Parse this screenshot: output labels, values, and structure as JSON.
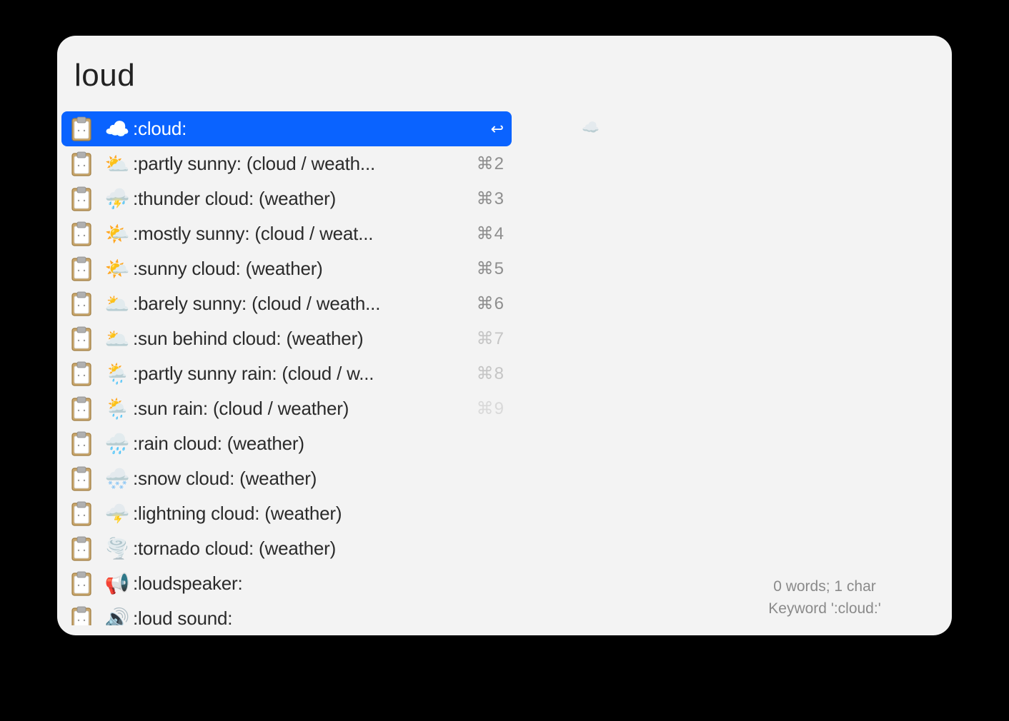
{
  "search": {
    "value": "loud"
  },
  "preview": {
    "emoji": "☁️"
  },
  "results": [
    {
      "emoji": "☁️",
      "label": ":cloud:",
      "shortcut": "↩",
      "shortcut_class": "enter",
      "selected": true
    },
    {
      "emoji": "⛅",
      "label": ":partly sunny: (cloud / weath...",
      "shortcut": "⌘2",
      "shortcut_class": ""
    },
    {
      "emoji": "⛈️",
      "label": ":thunder cloud: (weather)",
      "shortcut": "⌘3",
      "shortcut_class": ""
    },
    {
      "emoji": "🌤️",
      "label": ":mostly sunny: (cloud / weat...",
      "shortcut": "⌘4",
      "shortcut_class": ""
    },
    {
      "emoji": "🌤️",
      "label": ":sunny cloud: (weather)",
      "shortcut": "⌘5",
      "shortcut_class": ""
    },
    {
      "emoji": "🌥️",
      "label": ":barely sunny: (cloud / weath...",
      "shortcut": "⌘6",
      "shortcut_class": ""
    },
    {
      "emoji": "🌥️",
      "label": ":sun behind cloud: (weather)",
      "shortcut": "⌘7",
      "shortcut_class": "dim"
    },
    {
      "emoji": "🌦️",
      "label": ":partly sunny rain: (cloud / w...",
      "shortcut": "⌘8",
      "shortcut_class": "dim"
    },
    {
      "emoji": "🌦️",
      "label": ":sun rain: (cloud / weather)",
      "shortcut": "⌘9",
      "shortcut_class": "dimmer"
    },
    {
      "emoji": "🌧️",
      "label": ":rain cloud: (weather)",
      "shortcut": "",
      "shortcut_class": ""
    },
    {
      "emoji": "🌨️",
      "label": ":snow cloud: (weather)",
      "shortcut": "",
      "shortcut_class": ""
    },
    {
      "emoji": "🌩️",
      "label": ":lightning cloud: (weather)",
      "shortcut": "",
      "shortcut_class": ""
    },
    {
      "emoji": "🌪️",
      "label": ":tornado cloud: (weather)",
      "shortcut": "",
      "shortcut_class": ""
    },
    {
      "emoji": "📢",
      "label": ":loudspeaker:",
      "shortcut": "",
      "shortcut_class": ""
    },
    {
      "emoji": "🔊",
      "label": ":loud sound:",
      "shortcut": "",
      "shortcut_class": ""
    }
  ],
  "footer": {
    "line1": "0 words; 1 char",
    "line2": "Keyword ':cloud:'"
  }
}
